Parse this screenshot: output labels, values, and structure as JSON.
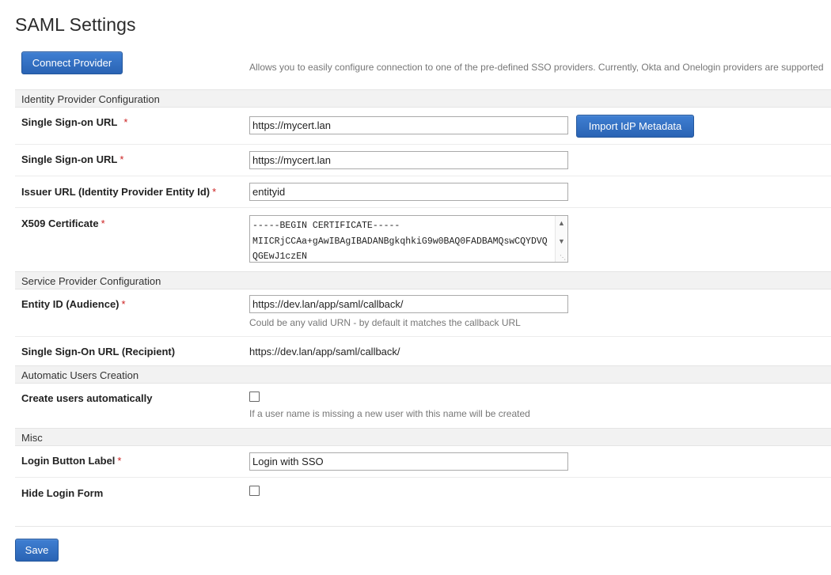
{
  "page": {
    "title": "SAML Settings"
  },
  "connect": {
    "button_label": "Connect Provider",
    "help": "Allows you to easily configure connection to one of the pre-defined SSO providers. Currently, Okta and Onelogin providers are supported"
  },
  "sections": {
    "idp": "Identity Provider Configuration",
    "sp": "Service Provider Configuration",
    "auto_users": "Automatic Users Creation",
    "misc": "Misc"
  },
  "fields": {
    "sso_url_1": {
      "label": "Single Sign-on URL",
      "required": "*",
      "value": "https://mycert.lan"
    },
    "import_button": "Import IdP Metadata",
    "sso_url_2": {
      "label": "Single Sign-on URL",
      "required": "*",
      "value": "https://mycert.lan"
    },
    "issuer_url": {
      "label": "Issuer URL (Identity Provider Entity Id)",
      "required": "*",
      "value": "entityid"
    },
    "x509": {
      "label": "X509 Certificate",
      "required": "*",
      "value": "-----BEGIN CERTIFICATE-----\nMIICRjCCAa+gAwIBAgIBADANBgkqhkiG9w0BAQ0FADBAMQswCQYDVQ\nQGEwJ1czEN"
    },
    "entity_id": {
      "label": "Entity ID (Audience)",
      "required": "*",
      "value": "https://dev.lan/app/saml/callback/",
      "help": "Could be any valid URN - by default it matches the callback URL"
    },
    "recipient": {
      "label": "Single Sign-On URL (Recipient)",
      "value": "https://dev.lan/app/saml/callback/"
    },
    "create_users": {
      "label": "Create users automatically",
      "checked": false,
      "help": "If a user name is missing a new user with this name will be created"
    },
    "login_button_label": {
      "label": "Login Button Label",
      "required": "*",
      "value": "Login with SSO"
    },
    "hide_login_form": {
      "label": "Hide Login Form",
      "checked": false
    }
  },
  "footer": {
    "save_label": "Save"
  }
}
